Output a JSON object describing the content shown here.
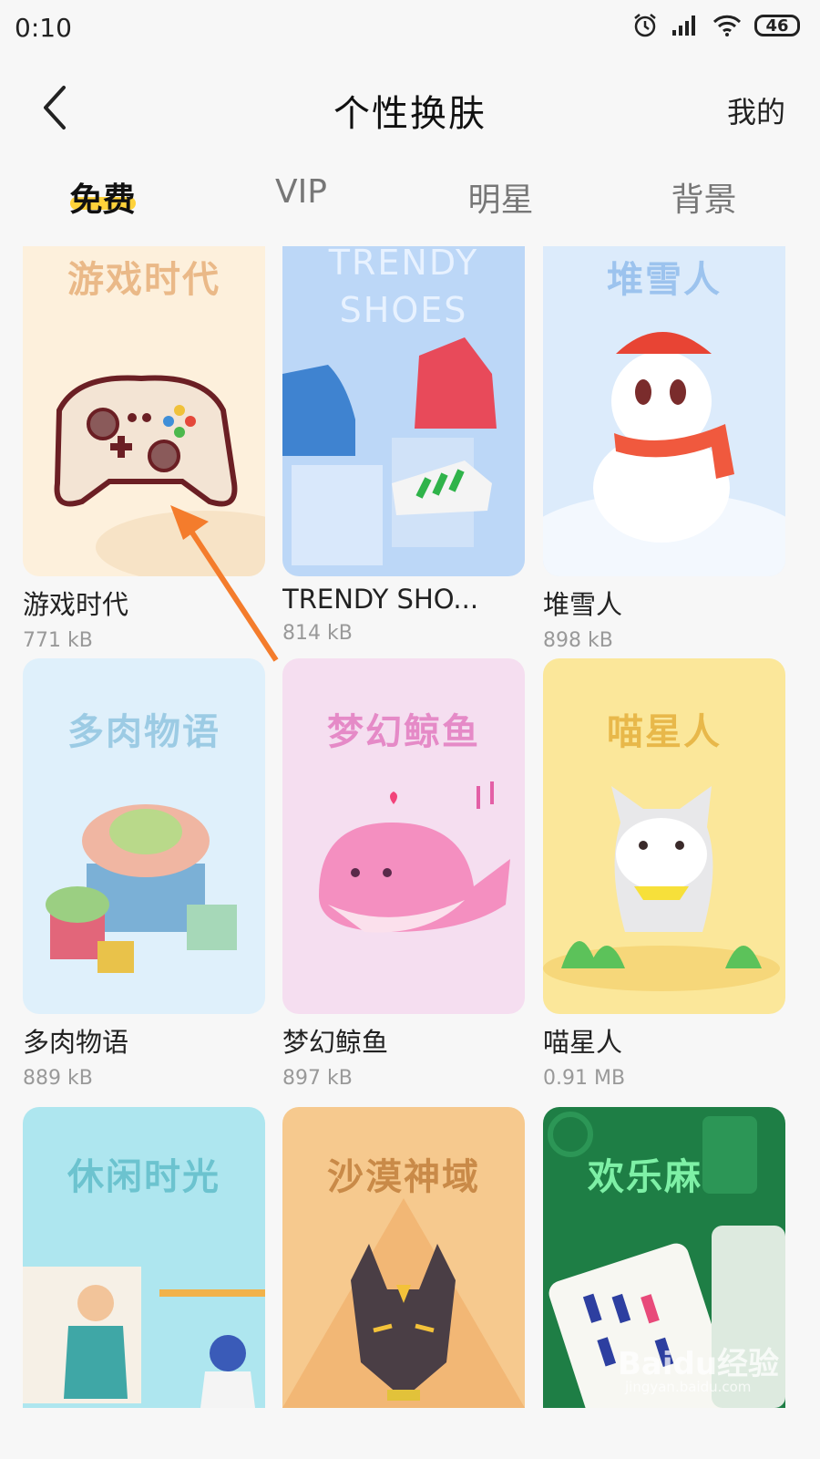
{
  "status": {
    "time": "0:10",
    "battery": "46"
  },
  "header": {
    "title": "个性换肤",
    "right_label": "我的"
  },
  "tabs": [
    {
      "label": "免费"
    },
    {
      "label": "VIP"
    },
    {
      "label": "明星"
    },
    {
      "label": "背景"
    }
  ],
  "themes": [
    {
      "name": "游戏时代",
      "size": "771 kB",
      "thumb_title": "游戏时代",
      "bg": "#fdf0dc",
      "title_color": "#eab988"
    },
    {
      "name": "TRENDY SHO...",
      "size": "814 kB",
      "thumb_title": "TRENDY SHOES",
      "bg": "#bcd7f7",
      "title_color": "#e8f2ff"
    },
    {
      "name": "堆雪人",
      "size": "898 kB",
      "thumb_title": "堆雪人",
      "bg": "#dcebfb",
      "title_color": "#9cc3ee"
    },
    {
      "name": "多肉物语",
      "size": "889 kB",
      "thumb_title": "多肉物语",
      "bg": "#dff0fb",
      "title_color": "#9ccbe4"
    },
    {
      "name": "梦幻鲸鱼",
      "size": "897 kB",
      "thumb_title": "梦幻鲸鱼",
      "bg": "#f5def0",
      "title_color": "#e58ac7"
    },
    {
      "name": "喵星人",
      "size": "0.91 MB",
      "thumb_title": "喵星人",
      "bg": "#fbe79a",
      "title_color": "#e8b84a"
    },
    {
      "name": "休闲时光",
      "size": "",
      "thumb_title": "休闲时光",
      "bg": "#aee6ef",
      "title_color": "#6cc3cf"
    },
    {
      "name": "沙漠神域",
      "size": "",
      "thumb_title": "沙漠神域",
      "bg": "#f6c98e",
      "title_color": "#c98a48"
    },
    {
      "name": "欢乐麻将",
      "size": "",
      "thumb_title": "欢乐麻将",
      "bg": "#1e7e45",
      "title_color": "#7ef0a6"
    }
  ],
  "watermark": {
    "text": "Baidu经验",
    "sub": "jingyan.baidu.com"
  },
  "colors": {
    "accent": "#ffd23a",
    "arrow": "#f47c2c"
  }
}
